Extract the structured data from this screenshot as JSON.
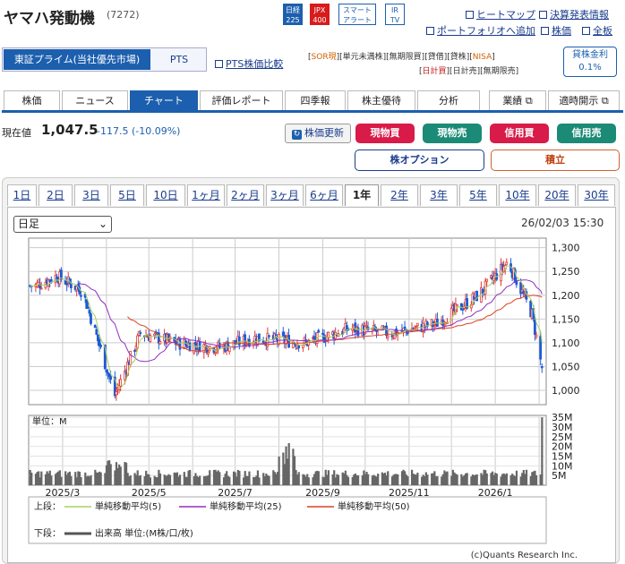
{
  "header": {
    "company": "ヤマハ発動機",
    "code": "(7272)",
    "badges": [
      {
        "top": "日経",
        "bottom": "225",
        "bg": "#1c5fae"
      },
      {
        "top": "JPX",
        "bottom": "400",
        "bg": "#d81b1b"
      },
      {
        "top": "スマート",
        "bottom": "アラート",
        "bg": "#ffffff"
      },
      {
        "top": "IR",
        "bottom": "TV",
        "bg": "#ffffff"
      }
    ],
    "links": {
      "heatmap": "ヒートマップ",
      "earnings": "決算発表情報",
      "portfolio": "ポートフォリオへ追加",
      "stock": "株価",
      "board": "全板"
    }
  },
  "market": {
    "primary": "東証プライム(当社優先市場)",
    "pts": "PTS",
    "pts_compare": "PTS株価比較",
    "tags_row1": [
      "SOR現",
      "単元未満株",
      "無期限買",
      "貸借",
      "貸株",
      "NISA"
    ],
    "tags_row2": [
      "日計買",
      "日計売",
      "無期限売"
    ],
    "lending_label": "貸株金利",
    "lending_rate": "0.1%"
  },
  "nav": {
    "tabs": [
      "株価",
      "ニュース",
      "チャート",
      "評価レポート",
      "四季報",
      "株主優待",
      "分析"
    ],
    "active": "チャート",
    "right1": "業績",
    "right2": "適時開示"
  },
  "price": {
    "label": "現在値",
    "value": "1,047.5",
    "change": "-117.5 (-10.09%)",
    "refresh": "株価更新",
    "buttons": {
      "buy_cash": "現物買",
      "sell_cash": "現物売",
      "buy_margin": "信用買",
      "sell_margin": "信用売"
    },
    "options": "株オプション",
    "accumulate": "積立"
  },
  "periods": [
    "1日",
    "2日",
    "3日",
    "5日",
    "10日",
    "1ヶ月",
    "2ヶ月",
    "3ヶ月",
    "6ヶ月",
    "1年",
    "2年",
    "3年",
    "5年",
    "10年",
    "20年",
    "30年"
  ],
  "active_period": "1年",
  "chart_select": "日足",
  "chart_datetime": "26/02/03 15:30",
  "legend": {
    "upper_label": "上段：",
    "ma5": "単純移動平均(5)",
    "ma25": "単純移動平均(25)",
    "ma50": "単純移動平均(50)",
    "lower_label": "下段：",
    "volume": "出来高 単位:(M株/口/枚)"
  },
  "credit": "(c)Quants Research Inc.",
  "colors": {
    "ma5": "#a8d060",
    "ma25": "#9030c0",
    "ma50": "#e04020",
    "up": "#e53935",
    "down": "#1e5bd6",
    "accent": "#1c5fae"
  },
  "chart_data": [
    {
      "type": "candlestick",
      "title": "",
      "x_ticks": [
        "2025/3",
        "2025/5",
        "2025/7",
        "2025/9",
        "2025/11",
        "2026/1"
      ],
      "y_ticks": [
        1000,
        1050,
        1100,
        1150,
        1200,
        1250,
        1300
      ],
      "ylim": [
        970,
        1320
      ],
      "grid": true,
      "approx_close_path": [
        {
          "x": "2025-02-10",
          "y": 1220
        },
        {
          "x": "2025-02-25",
          "y": 1240
        },
        {
          "x": "2025-03-15",
          "y": 1210
        },
        {
          "x": "2025-04-07",
          "y": 990
        },
        {
          "x": "2025-04-25",
          "y": 1120
        },
        {
          "x": "2025-05-20",
          "y": 1100
        },
        {
          "x": "2025-06-20",
          "y": 1090
        },
        {
          "x": "2025-07-15",
          "y": 1110
        },
        {
          "x": "2025-08-20",
          "y": 1100
        },
        {
          "x": "2025-09-20",
          "y": 1130
        },
        {
          "x": "2025-10-20",
          "y": 1120
        },
        {
          "x": "2025-11-20",
          "y": 1140
        },
        {
          "x": "2025-12-20",
          "y": 1200
        },
        {
          "x": "2026-01-10",
          "y": 1270
        },
        {
          "x": "2026-01-27",
          "y": 1160
        },
        {
          "x": "2026-02-03",
          "y": 1047.5
        }
      ]
    },
    {
      "type": "bar",
      "title": "",
      "ylabel": "単位：M",
      "y_ticks": [
        "5M",
        "10M",
        "15M",
        "20M",
        "25M",
        "30M",
        "35M"
      ],
      "ylim": [
        0,
        36
      ]
    }
  ]
}
